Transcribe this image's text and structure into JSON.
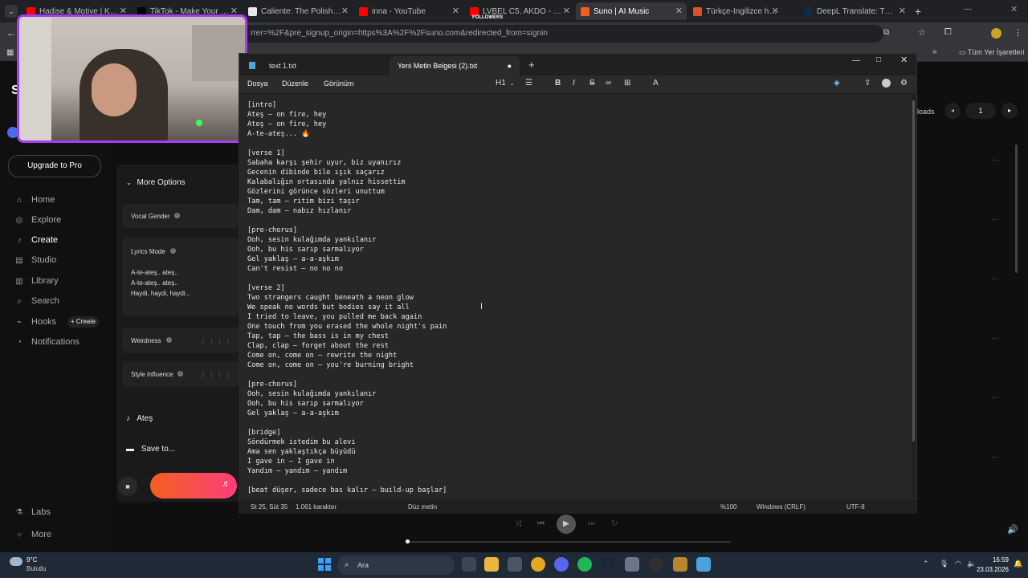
{
  "browser": {
    "tabs": [
      {
        "title": "Hadise & Motive | Küçük",
        "color": "#ff0000",
        "active": false
      },
      {
        "title": "TikTok - Make Your Day",
        "color": "#000000",
        "active": false
      },
      {
        "title": "Caliente: The Polish Comm",
        "color": "#e8e8e8",
        "active": false
      },
      {
        "title": "inna - YouTube",
        "color": "#ff0000",
        "active": false
      },
      {
        "title": "LVBEL C5, AKDO - vOl",
        "color": "#ff0000",
        "active": false
      },
      {
        "title": "Suno | AI Music",
        "color": "#f2601f",
        "active": true
      },
      {
        "title": "Türkçe-İngilizce hit şarkı",
        "color": "#d9542b",
        "active": false
      },
      {
        "title": "DeepL Translate: The wor",
        "color": "#0f2b46",
        "active": false
      }
    ],
    "url": "rrer=%2F&pre_signup_origin=https%3A%2F%2Fsuno.com&redirected_from=signin",
    "bookmarks_label": "Tüm Yer İşaretleri",
    "overlay_followers": "FOLLOWERS"
  },
  "suno": {
    "upgrade_label": "Upgrade to Pro",
    "nav": [
      {
        "label": "Home",
        "icon": "home-icon",
        "active": false
      },
      {
        "label": "Explore",
        "icon": "compass-icon",
        "active": false
      },
      {
        "label": "Create",
        "icon": "music-note-icon",
        "active": true
      },
      {
        "label": "Studio",
        "icon": "studio-icon",
        "active": false
      },
      {
        "label": "Library",
        "icon": "library-icon",
        "active": false
      },
      {
        "label": "Search",
        "icon": "search-icon",
        "active": false
      },
      {
        "label": "Hooks",
        "icon": "hooks-icon",
        "active": false
      },
      {
        "label": "Notifications",
        "icon": "bell-icon",
        "active": false
      }
    ],
    "hooks_create": "+ Create",
    "bottom_nav": [
      {
        "label": "Labs",
        "icon": "flask-icon"
      },
      {
        "label": "More",
        "icon": "more-icon"
      }
    ],
    "more_options": "More Options",
    "vocal_gender": "Vocal Gender",
    "lyrics_mode": "Lyrics Mode",
    "lyrics_preview": [
      "A-te-ateş.. ateş..",
      "A-te-ateş.. ateş..",
      "Haydi, haydi, haydi..."
    ],
    "weirdness": "Weirdness",
    "style_influence": "Style Influence",
    "song_title": "Ateş",
    "save_to": "Save to...",
    "right_header": "loads",
    "page_number": "1"
  },
  "notepad": {
    "tabs": [
      {
        "label": "text 1.txt",
        "active": false
      },
      {
        "label": "Yeni Metin Belgesi (2).txt",
        "active": true
      }
    ],
    "menu": [
      "Dosya",
      "Düzenle",
      "Görünüm"
    ],
    "heading_select": "H1",
    "lines": [
      "[intro]",
      "Ateş — on fire, hey",
      "Ateş — on fire, hey",
      "A-te-ateş... 🔥",
      "",
      "[verse 1]",
      "Sabaha karşı şehir uyur, biz uyanırız",
      "Gecenin dibinde bile ışık saçarız",
      "Kalabalığın ortasında yalnız hissettim",
      "Gözlerini görünce sözleri unuttum",
      "Tam, tam — ritim bizi taşır",
      "Dam, dam — nabız hızlanır",
      "",
      "[pre-chorus]",
      "Ooh, sesin kulağımda yankılanır",
      "Ooh, bu his sarıp sarmalıyor",
      "Gel yaklaş — a-a-aşkım",
      "Can't resist — no no no",
      "",
      "[verse 2]",
      "Two strangers caught beneath a neon glow",
      "We speak no words but bodies say it all",
      "I tried to leave, you pulled me back again",
      "One touch from you erased the whole night's pain",
      "Tap, tap — the bass is in my chest",
      "Clap, clap — forget about the rest",
      "Come on, come on — rewrite the night",
      "Come on, come on — you're burning bright",
      "",
      "[pre-chorus]",
      "Ooh, sesin kulağımda yankılanır",
      "Ooh, bu his sarıp sarmalıyor",
      "Gel yaklaş — a-a-aşkım",
      "",
      "[bridge]",
      "Söndürmek istedim bu alevi",
      "Ama sen yaklaştıkça büyüdü",
      "I gave in — I gave in",
      "Yandım — yandım — yandım",
      "",
      "[beat düşer, sadece bas kalır — build-up başlar]"
    ],
    "status": {
      "position": "St 25, Süt 35",
      "chars": "1.061 karakter",
      "format": "Düz metin",
      "zoom": "%100",
      "line_ending": "Windows (CRLF)",
      "encoding": "UTF-8"
    }
  },
  "taskbar": {
    "weather_temp": "9°C",
    "weather_desc": "Bulutlu",
    "search_label": "Ara",
    "time": "16:59",
    "date": "23.03.2026"
  },
  "colors": {
    "accent_purple": "#a63cf0",
    "suno_orange": "#f2601f",
    "win_blue": "#0078d4"
  }
}
